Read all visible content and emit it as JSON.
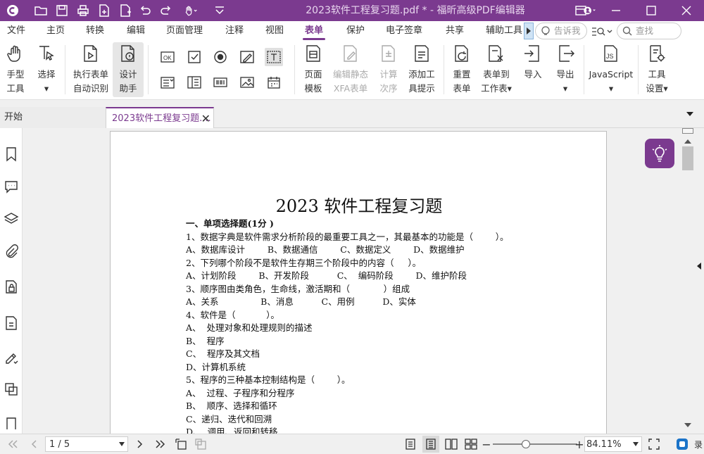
{
  "window": {
    "title": "2023软件工程复习题.pdf * - 福昕高级PDF编辑器"
  },
  "menu": [
    "文件",
    "主页",
    "转换",
    "编辑",
    "页面管理",
    "注释",
    "视图",
    "表单",
    "保护",
    "电子签章",
    "共享",
    "辅助工具"
  ],
  "menu_active": "表单",
  "tell_me": "告诉我",
  "search_placeholder": "查找",
  "ribbon": {
    "hand": [
      "手型",
      "工具"
    ],
    "select": [
      "选择"
    ],
    "run_form": [
      "执行表单",
      "自动识别"
    ],
    "design": [
      "设计",
      "助手"
    ],
    "page_template": [
      "页面",
      "模板"
    ],
    "edit_xfa": [
      "编辑静态",
      "XFA表单"
    ],
    "calc_order": [
      "计算",
      "次序"
    ],
    "add_hint": [
      "添加工",
      "具提示"
    ],
    "reset": [
      "重置",
      "表单"
    ],
    "form_to_sheet": [
      "表单到",
      "工作表"
    ],
    "import": [
      "导入"
    ],
    "export": [
      "导出"
    ],
    "javascript": [
      "JavaScript"
    ],
    "tool_settings": [
      "工具",
      "设置"
    ]
  },
  "tabs": {
    "start": "开始",
    "doc": "2023软件工程复习题...."
  },
  "doc": {
    "title": "2023 软件工程复习题",
    "lines": [
      "一、单项选择题(1分 )",
      "1、数据字典是软件需求分析阶段的最重要工具之一，其最基本的功能是（        ）。",
      "A、数据库设计        B、数据通信        C、数据定义        D、数据维护",
      "2、下列哪个阶段不是软件生存期三个阶段中的内容（     ）。",
      "A、计划阶段        B、开发阶段          C、  编码阶段        D、维护阶段",
      "3、顺序图由类角色，生命线，激活期和（            ）组成",
      "A、关系               B、消息          C、用例          D、实体",
      "4、软件是（           ）。",
      "A、  处理对象和处理规则的描述",
      "B、  程序",
      "C、  程序及其文档",
      "D、计算机系统",
      "5、程序的三种基本控制结构是（        ）。",
      "A、  过程、子程序和分程序",
      "B、  顺序、选择和循环",
      "C、递归、迭代和回溯",
      "D、  调用、返回和转移"
    ]
  },
  "status": {
    "page": "1 / 5",
    "zoom": "84.11%"
  },
  "accent": "#7b3a8f"
}
